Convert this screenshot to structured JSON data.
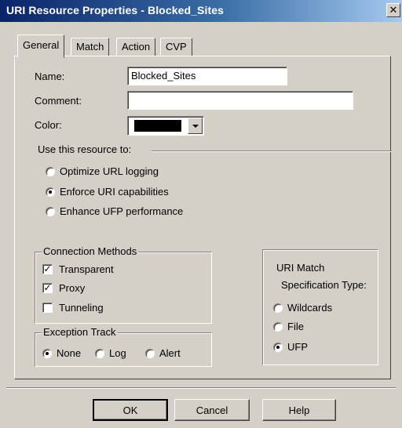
{
  "window": {
    "title": "URI Resource Properties - Blocked_Sites",
    "close_label": "✕"
  },
  "tabs": [
    {
      "label": "General",
      "active": true
    },
    {
      "label": "Match",
      "active": false
    },
    {
      "label": "Action",
      "active": false
    },
    {
      "label": "CVP",
      "active": false
    }
  ],
  "form": {
    "name_label": "Name:",
    "name_value": "Blocked_Sites",
    "comment_label": "Comment:",
    "comment_value": "",
    "color_label": "Color:",
    "color_value": "#000000"
  },
  "use_resource": {
    "label": "Use this resource to:",
    "options": [
      {
        "label": "Optimize URL logging",
        "selected": false
      },
      {
        "label": "Enforce URI capabilities",
        "selected": true
      },
      {
        "label": "Enhance UFP performance",
        "selected": false
      }
    ]
  },
  "connection_methods": {
    "title": "Connection Methods",
    "items": [
      {
        "label": "Transparent",
        "checked": true
      },
      {
        "label": "Proxy",
        "checked": true
      },
      {
        "label": "Tunneling",
        "checked": false
      }
    ]
  },
  "exception_track": {
    "title": "Exception Track",
    "options": [
      {
        "label": "None",
        "selected": true
      },
      {
        "label": "Log",
        "selected": false
      },
      {
        "label": "Alert",
        "selected": false
      }
    ]
  },
  "uri_match": {
    "title_line1": "URI Match",
    "title_line2": "Specification Type:",
    "options": [
      {
        "label": "Wildcards",
        "selected": false
      },
      {
        "label": "File",
        "selected": false
      },
      {
        "label": "UFP",
        "selected": true
      }
    ]
  },
  "buttons": {
    "ok": "OK",
    "cancel": "Cancel",
    "help": "Help"
  }
}
